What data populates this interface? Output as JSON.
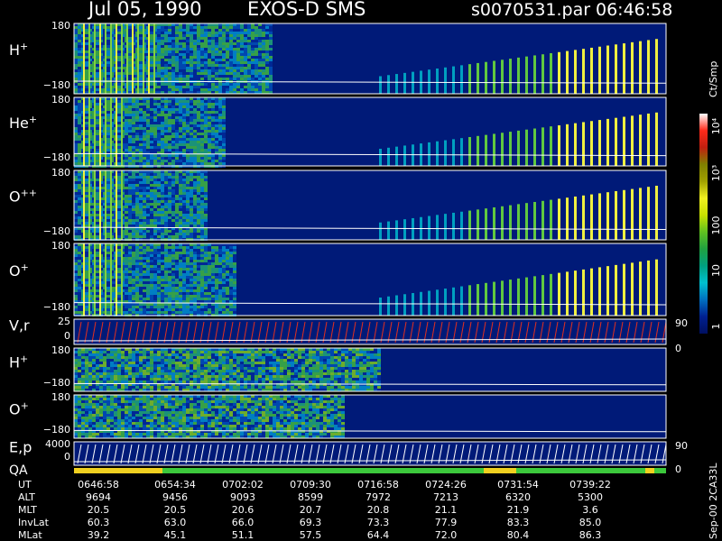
{
  "header": {
    "date": "Jul 05, 1990",
    "mission": "EXOS-D SMS",
    "file": "s0070531.par",
    "clock": "06:46:58"
  },
  "colorbar": {
    "unit_label": "Ct/Smp",
    "labels": [
      "10⁴",
      "10³",
      "100",
      "10",
      "1"
    ],
    "stops": [
      "#ffffff",
      "#ff2a1a",
      "#c02010",
      "#808000",
      "#a0a000",
      "#f0f020",
      "#c8e000",
      "#60c020",
      "#20a040",
      "#00a080",
      "#00c0d0",
      "#0070c0",
      "#002090",
      "#001060"
    ]
  },
  "panels": [
    {
      "id": "p1",
      "label": "H",
      "sup": "+",
      "ymax": "180",
      "ymin": "−180"
    },
    {
      "id": "p2",
      "label": "He",
      "sup": "+",
      "ymax": "180",
      "ymin": "−180"
    },
    {
      "id": "p3",
      "label": "O",
      "sup": "++",
      "ymax": "180",
      "ymin": "−180"
    },
    {
      "id": "p4",
      "label": "O",
      "sup": "+",
      "ymax": "180",
      "ymin": "−180"
    },
    {
      "id": "p5",
      "label": "V,r",
      "sup": "",
      "ymax": "25",
      "ymin": "0",
      "right_top": "90",
      "right_bot": "0"
    },
    {
      "id": "p6",
      "label": "H",
      "sup": "+",
      "ymax": "180",
      "ymin": "−180"
    },
    {
      "id": "p7",
      "label": "O",
      "sup": "+",
      "ymax": "180",
      "ymin": "−180"
    },
    {
      "id": "p8",
      "label": "E,p",
      "sup": "",
      "ymax": "4000",
      "ymin": "0",
      "right_top": "90",
      "right_bot": "0"
    }
  ],
  "qa_label": "QA",
  "footer": {
    "side_stamp": "Sep-00  2CA33L",
    "rows": [
      {
        "label": "UT",
        "values": [
          "0646:58",
          "0654:34",
          "0702:02",
          "0709:30",
          "0716:58",
          "0724:26",
          "0731:54",
          "0739:22"
        ]
      },
      {
        "label": "ALT",
        "values": [
          "9694",
          "9456",
          "9093",
          "8599",
          "7972",
          "7213",
          "6320",
          "5300"
        ]
      },
      {
        "label": "MLT",
        "values": [
          "20.5",
          "20.5",
          "20.6",
          "20.7",
          "20.8",
          "21.1",
          "21.9",
          "3.6"
        ]
      },
      {
        "label": "InvLat",
        "values": [
          "60.3",
          "63.0",
          "66.0",
          "69.3",
          "73.3",
          "77.9",
          "83.3",
          "85.0"
        ]
      },
      {
        "label": "MLat",
        "values": [
          "39.2",
          "45.1",
          "51.1",
          "57.5",
          "64.4",
          "72.0",
          "80.4",
          "86.3"
        ]
      }
    ]
  },
  "chart_data": {
    "type": "heatmap",
    "title": "Jul 05, 1990   EXOS-D SMS",
    "x_ticks": [
      "0646:58",
      "0654:34",
      "0702:02",
      "0709:30",
      "0716:58",
      "0724:26",
      "0731:54",
      "0739:22"
    ],
    "series": [
      {
        "name": "H+",
        "ylim": [
          -180,
          180
        ]
      },
      {
        "name": "He+",
        "ylim": [
          -180,
          180
        ]
      },
      {
        "name": "O++",
        "ylim": [
          -180,
          180
        ]
      },
      {
        "name": "O+",
        "ylim": [
          -180,
          180
        ]
      },
      {
        "name": "V,r",
        "ylim": [
          0,
          25
        ]
      },
      {
        "name": "H+",
        "ylim": [
          -180,
          180
        ]
      },
      {
        "name": "O+",
        "ylim": [
          -180,
          180
        ]
      },
      {
        "name": "E,p",
        "ylim": [
          0,
          4000
        ]
      }
    ],
    "colorbar_range": [
      1,
      10000
    ],
    "colorbar_scale": "log",
    "colorbar_label": "Ct/Smp"
  }
}
